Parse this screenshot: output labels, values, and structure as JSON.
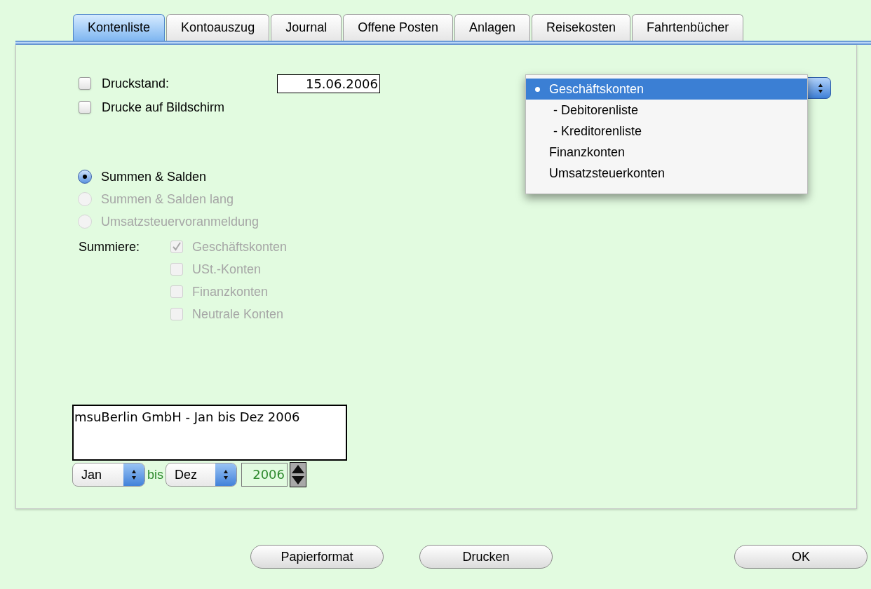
{
  "tabs": [
    {
      "label": "Kontenliste",
      "selected": true
    },
    {
      "label": "Kontoauszug",
      "selected": false
    },
    {
      "label": "Journal",
      "selected": false
    },
    {
      "label": "Offene Posten",
      "selected": false
    },
    {
      "label": "Anlagen",
      "selected": false
    },
    {
      "label": "Reisekosten",
      "selected": false
    },
    {
      "label": "Fahrtenbücher",
      "selected": false
    }
  ],
  "print_options": [
    {
      "label": "Druckstand:",
      "checked": false
    },
    {
      "label": "Drucke auf Bildschirm",
      "checked": false
    }
  ],
  "print_date": {
    "value": "15.06.2006"
  },
  "report_types": [
    {
      "label": "Summen & Salden",
      "selected": true,
      "disabled": false
    },
    {
      "label": "Summen & Salden lang",
      "selected": false,
      "disabled": true
    },
    {
      "label": "Umsatzsteuervoranmeldung",
      "selected": false,
      "disabled": true
    }
  ],
  "sum_label": "Summiere:",
  "sum_accounts": [
    {
      "label": "Geschäftskonten",
      "checked": true,
      "disabled": true
    },
    {
      "label": "USt.-Konten",
      "checked": false,
      "disabled": true
    },
    {
      "label": "Finanzkonten",
      "checked": false,
      "disabled": true
    },
    {
      "label": "Neutrale Konten",
      "checked": false,
      "disabled": true
    }
  ],
  "account_menu": {
    "items": [
      {
        "label": "Geschäftskonten",
        "selected": true,
        "children": [
          {
            "label": "- Debitorenliste",
            "selected": false
          },
          {
            "label": "- Kreditorenliste",
            "selected": false
          }
        ]
      },
      {
        "label": "Finanzkonten",
        "selected": false
      },
      {
        "label": "Umsatzsteuerkonten",
        "selected": false
      }
    ]
  },
  "header_text": {
    "value": "msuBerlin GmbH - Jan bis Dez 2006"
  },
  "period": {
    "from": "Jan",
    "separator": "bis",
    "to": "Dez",
    "year": "2006"
  },
  "buttons": [
    {
      "label": "Papierformat"
    },
    {
      "label": "Drucken"
    },
    {
      "label": "OK"
    }
  ]
}
